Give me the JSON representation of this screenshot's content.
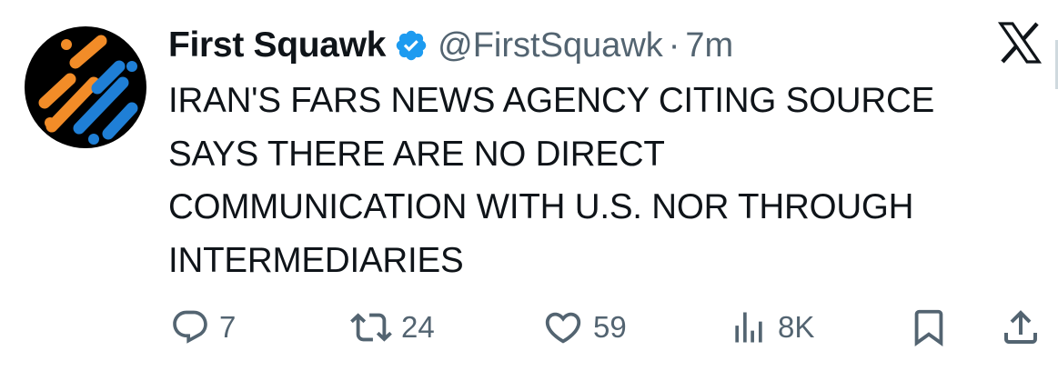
{
  "tweet": {
    "author": {
      "display_name": "First Squawk",
      "handle": "@FirstSquawk",
      "verified_icon": "verified-badge-icon"
    },
    "separator": "·",
    "time": "7m",
    "brand_icon": "x-logo-icon",
    "text_lines": [
      "IRAN'S FARS NEWS AGENCY CITING SOURCE",
      "SAYS THERE ARE NO DIRECT",
      "COMMUNICATION WITH U.S. NOR THROUGH",
      "INTERMEDIARIES"
    ],
    "actions": {
      "reply": {
        "icon": "reply-icon",
        "count": "7"
      },
      "repost": {
        "icon": "repost-icon",
        "count": "24"
      },
      "like": {
        "icon": "heart-icon",
        "count": "59"
      },
      "views": {
        "icon": "views-icon",
        "count": "8K"
      },
      "bookmark": {
        "icon": "bookmark-icon"
      },
      "share": {
        "icon": "share-icon"
      }
    }
  },
  "colors": {
    "text_primary": "#0f1419",
    "text_secondary": "#536471",
    "verified_blue": "#1d9bf0",
    "avatar_orange": "#f28c28",
    "avatar_blue": "#1f7fd6",
    "avatar_background": "#000000"
  }
}
